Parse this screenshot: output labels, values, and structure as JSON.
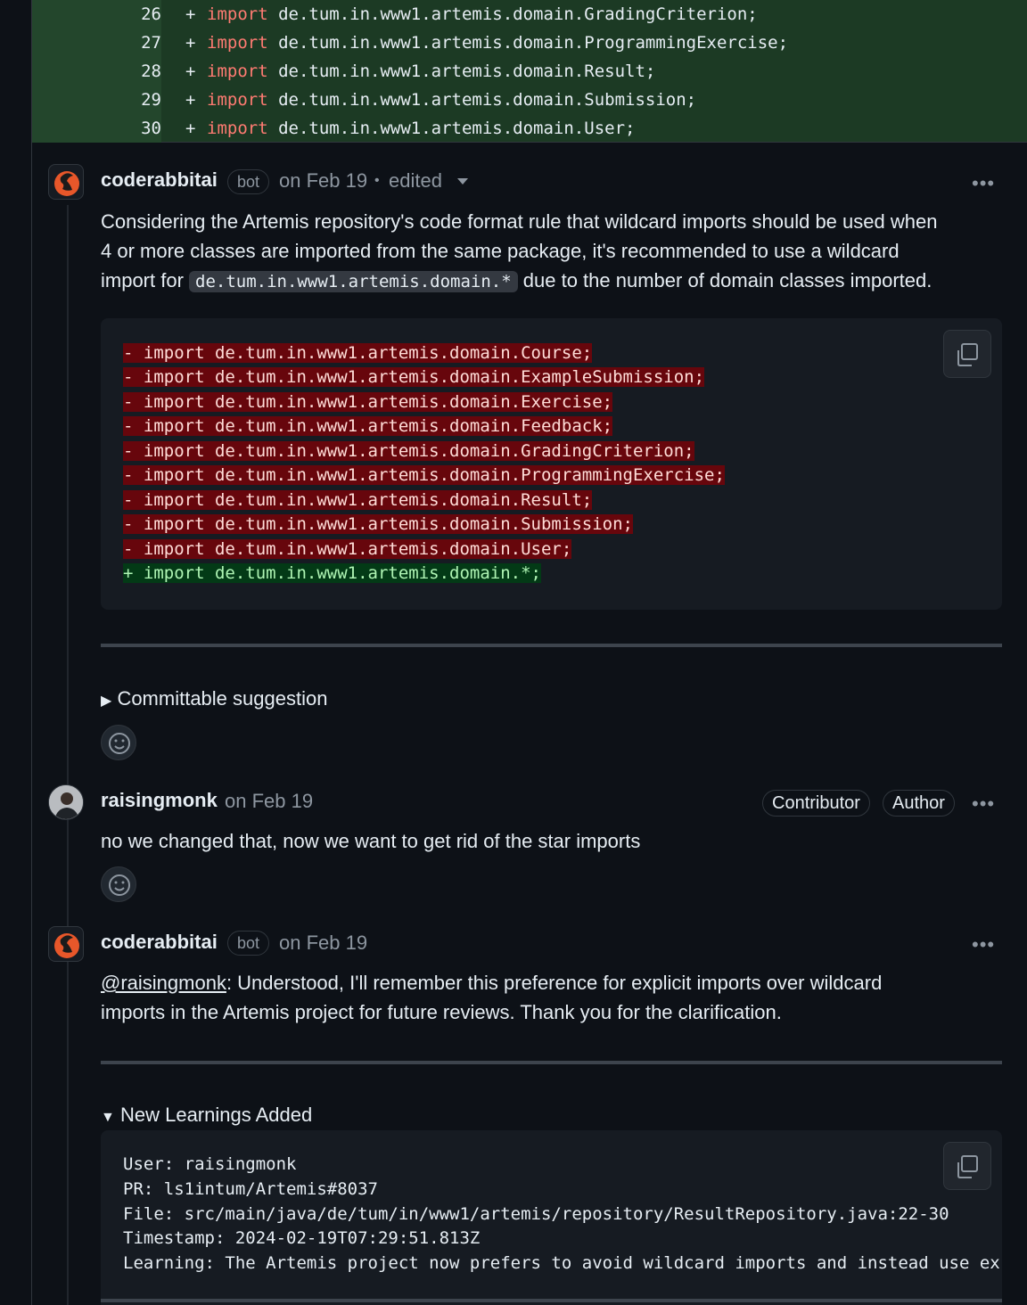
{
  "diff": {
    "rows": [
      {
        "num": "26",
        "sign": "+",
        "kw": "import",
        "rest": " de.tum.in.www1.artemis.domain.GradingCriterion;"
      },
      {
        "num": "27",
        "sign": "+",
        "kw": "import",
        "rest": " de.tum.in.www1.artemis.domain.ProgrammingExercise;"
      },
      {
        "num": "28",
        "sign": "+",
        "kw": "import",
        "rest": " de.tum.in.www1.artemis.domain.Result;"
      },
      {
        "num": "29",
        "sign": "+",
        "kw": "import",
        "rest": " de.tum.in.www1.artemis.domain.Submission;"
      },
      {
        "num": "30",
        "sign": "+",
        "kw": "import",
        "rest": " de.tum.in.www1.artemis.domain.User;"
      }
    ]
  },
  "comment1": {
    "author": "coderabbitai",
    "badge": "bot",
    "date": "on Feb 19",
    "separator": "•",
    "edited": "edited",
    "more": "•••",
    "text_line1": "Considering the Artemis repository's code format rule that wildcard imports should be used when",
    "text_line2": "4 or more classes are imported from the same package, it's recommended to use a wildcard",
    "text_line3_pre": "import for",
    "text_line3_code": "de.tum.in.www1.artemis.domain.*",
    "text_line3_post": "due to the number of domain classes imported.",
    "code_lines": [
      {
        "type": "del",
        "text": "- import de.tum.in.www1.artemis.domain.Course;"
      },
      {
        "type": "del",
        "text": "- import de.tum.in.www1.artemis.domain.ExampleSubmission;"
      },
      {
        "type": "del",
        "text": "- import de.tum.in.www1.artemis.domain.Exercise;"
      },
      {
        "type": "del",
        "text": "- import de.tum.in.www1.artemis.domain.Feedback;"
      },
      {
        "type": "del",
        "text": "- import de.tum.in.www1.artemis.domain.GradingCriterion;"
      },
      {
        "type": "del",
        "text": "- import de.tum.in.www1.artemis.domain.ProgrammingExercise;"
      },
      {
        "type": "del",
        "text": "- import de.tum.in.www1.artemis.domain.Result;"
      },
      {
        "type": "del",
        "text": "- import de.tum.in.www1.artemis.domain.Submission;"
      },
      {
        "type": "del",
        "text": "- import de.tum.in.www1.artemis.domain.User;"
      },
      {
        "type": "add",
        "text": "+ import de.tum.in.www1.artemis.domain.*;"
      }
    ],
    "summary": "Committable suggestion",
    "summary_marker": "▶"
  },
  "comment2": {
    "author": "raisingmonk",
    "date": "on Feb 19",
    "badge_contributor": "Contributor",
    "badge_author": "Author",
    "more": "•••",
    "text": "no we changed that, now we want to get rid of the star imports"
  },
  "comment3": {
    "author": "coderabbitai",
    "badge": "bot",
    "date": "on Feb 19",
    "more": "•••",
    "mention": "@raisingmonk",
    "text_line1_rest": ": Understood, I'll remember this preference for explicit imports over wildcard",
    "text_line2": "imports in the Artemis project for future reviews. Thank you for the clarification.",
    "summary_marker": "▼",
    "summary": "New Learnings Added",
    "learning_lines": [
      "User: raisingmonk",
      "PR: ls1intum/Artemis#8037",
      "File: src/main/java/de/tum/in/www1/artemis/repository/ResultRepository.java:22-30",
      "Timestamp: 2024-02-19T07:29:51.813Z",
      "Learning: The Artemis project now prefers to avoid wildcard imports and instead use ex"
    ]
  },
  "colors": {
    "bg": "#0d1117",
    "diff_add_bg": "#1c3a24",
    "keyword": "#ff7b72",
    "deletion": "#67060c",
    "addition": "#033a16",
    "muted": "#8d96a0"
  }
}
